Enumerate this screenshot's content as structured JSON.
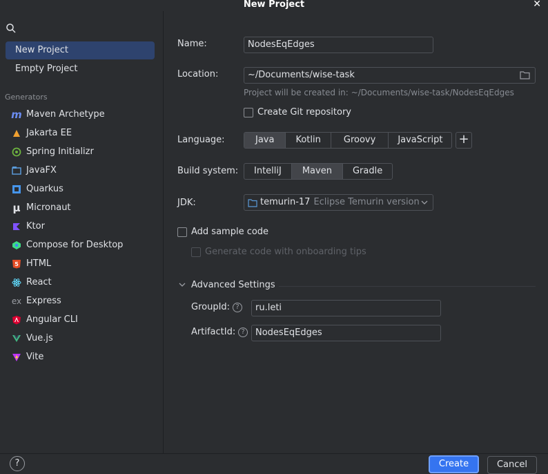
{
  "window": {
    "title": "New Project",
    "close_icon": "close-icon"
  },
  "sidebar": {
    "search_icon": "search-icon",
    "items": [
      {
        "label": "New Project",
        "selected": true
      },
      {
        "label": "Empty Project",
        "selected": false
      }
    ],
    "generators_label": "Generators",
    "generators": [
      {
        "label": "Maven Archetype",
        "icon": "maven-icon",
        "color": "#6b8cf0"
      },
      {
        "label": "Jakarta EE",
        "icon": "jakarta-icon",
        "color": "#f0a030"
      },
      {
        "label": "Spring Initializr",
        "icon": "spring-icon",
        "color": "#6db33f"
      },
      {
        "label": "JavaFX",
        "icon": "javafx-icon",
        "color": "#5a9ad8"
      },
      {
        "label": "Quarkus",
        "icon": "quarkus-icon",
        "color": "#4695eb"
      },
      {
        "label": "Micronaut",
        "icon": "micronaut-icon",
        "color": "#dfe1e5"
      },
      {
        "label": "Ktor",
        "icon": "ktor-icon",
        "color": "#7f52ff"
      },
      {
        "label": "Compose for Desktop",
        "icon": "compose-icon",
        "color": "#3ddc84"
      },
      {
        "label": "HTML",
        "icon": "html-icon",
        "color": "#e44d26"
      },
      {
        "label": "React",
        "icon": "react-icon",
        "color": "#61dafb"
      },
      {
        "label": "Express",
        "icon": "express-icon",
        "color": "#9a9da3"
      },
      {
        "label": "Angular CLI",
        "icon": "angular-icon",
        "color": "#dd0031"
      },
      {
        "label": "Vue.js",
        "icon": "vue-icon",
        "color": "#41b883"
      },
      {
        "label": "Vite",
        "icon": "vite-icon",
        "color": "#bd34fe"
      }
    ]
  },
  "form": {
    "name_label": "Name:",
    "name_value": "NodesEqEdges",
    "location_label": "Location:",
    "location_value": "~/Documents/wise-task",
    "location_hint": "Project will be created in: ~/Documents/wise-task/NodesEqEdges",
    "git_label": "Create Git repository",
    "language_label": "Language:",
    "languages": [
      "Java",
      "Kotlin",
      "Groovy",
      "JavaScript"
    ],
    "language_selected": "Java",
    "build_label": "Build system:",
    "build_systems": [
      "IntelliJ",
      "Maven",
      "Gradle"
    ],
    "build_selected": "Maven",
    "jdk_label": "JDK:",
    "jdk_name": "temurin-17",
    "jdk_desc": "Eclipse Temurin version",
    "sample_label": "Add sample code",
    "onboarding_label": "Generate code with onboarding tips",
    "advanced_label": "Advanced Settings",
    "groupid_label": "GroupId:",
    "groupid_value": "ru.leti",
    "artifactid_label": "ArtifactId:",
    "artifactid_value": "NodesEqEdges"
  },
  "footer": {
    "help": "?",
    "create_label": "Create",
    "cancel_label": "Cancel"
  }
}
